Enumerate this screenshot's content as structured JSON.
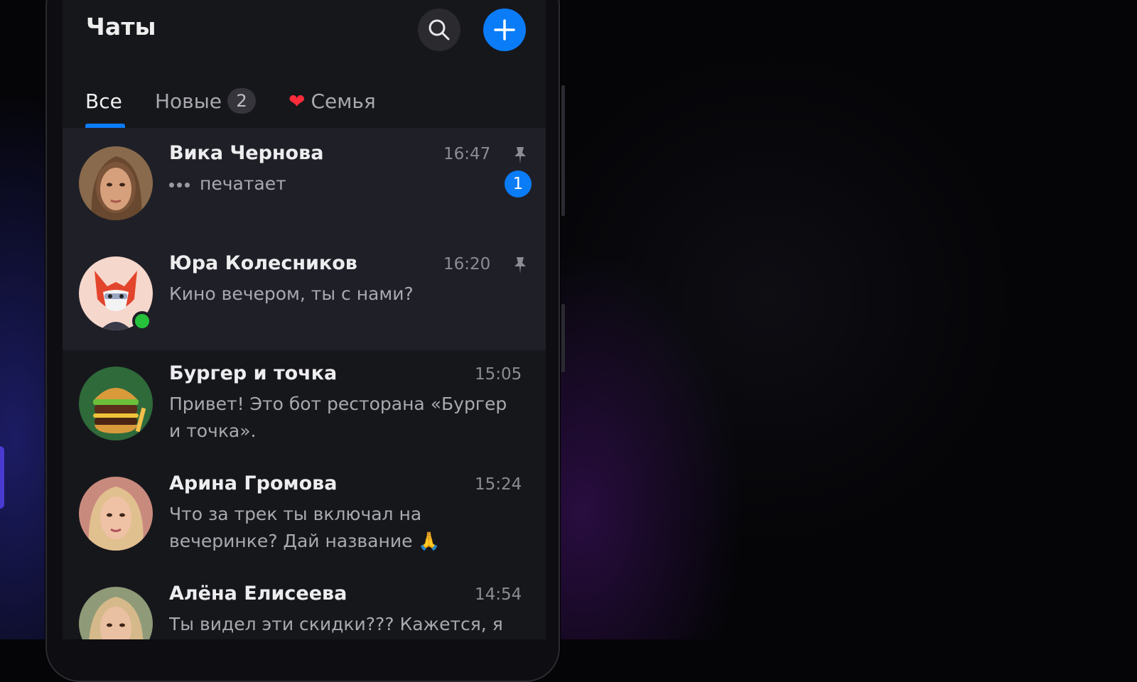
{
  "header": {
    "title": "Чаты",
    "search_icon": "search-icon",
    "add_icon": "plus-icon"
  },
  "tabs": [
    {
      "label": "Все",
      "active": true
    },
    {
      "label": "Новые",
      "badge": "2"
    },
    {
      "label": "Семья",
      "icon": "heart-icon"
    }
  ],
  "chats": [
    {
      "name": "Вика Чернова",
      "time": "16:47",
      "message": "печатает",
      "typing": true,
      "pinned": true,
      "unread": "1"
    },
    {
      "name": "Юра Колесников",
      "time": "16:20",
      "message": "Кино вечером, ты с нами?",
      "pinned": true,
      "online": true
    },
    {
      "name": "Бургер и точка",
      "time": "15:05",
      "message": "Привет! Это бот ресторана «Бургер и точка»."
    },
    {
      "name": "Арина Громова",
      "time": "15:24",
      "message": "Что за трек ты включал на вечеринке? Дай название 🙏"
    },
    {
      "name": "Алёна Елисеева",
      "time": "14:54",
      "message": "Ты видел эти скидки??? Кажется, я"
    }
  ],
  "colors": {
    "accent": "#0b7cf7",
    "background": "#16171b",
    "pinned_row": "#1f2027",
    "online": "#26c23c",
    "heart": "#ff2d3a"
  }
}
